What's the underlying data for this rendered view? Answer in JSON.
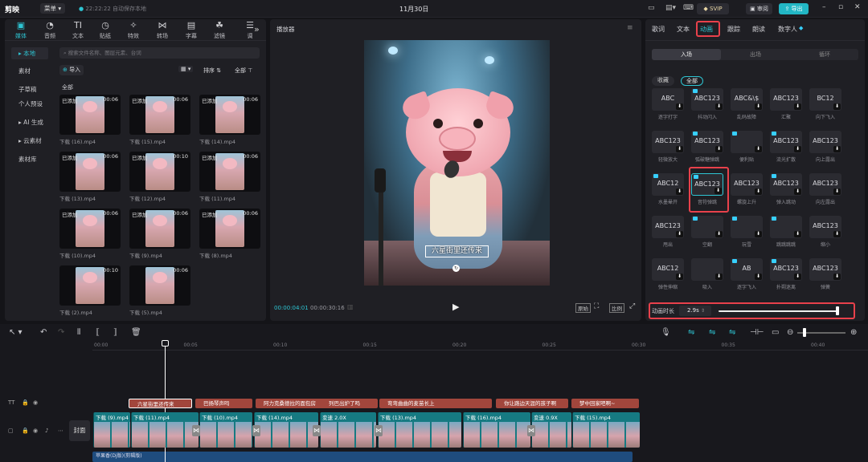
{
  "app": {
    "name": "剪映",
    "menu_label": "菜单",
    "autosave": "22:22:22 自动保存本地",
    "project_date": "11月30日",
    "svip_label": "SVIP",
    "review_label": "审阅",
    "export_label": "导出"
  },
  "toolbar_tabs": [
    {
      "label": "媒体",
      "icon": "media-icon"
    },
    {
      "label": "音频",
      "icon": "audio-icon"
    },
    {
      "label": "文本",
      "icon": "text-icon"
    },
    {
      "label": "贴纸",
      "icon": "sticker-icon"
    },
    {
      "label": "特效",
      "icon": "effects-icon"
    },
    {
      "label": "转场",
      "icon": "transition-icon"
    },
    {
      "label": "字幕",
      "icon": "caption-icon"
    },
    {
      "label": "滤镜",
      "icon": "filter-icon"
    },
    {
      "label": "调",
      "icon": "adjust-icon"
    }
  ],
  "sidebar": {
    "items": [
      "本地",
      "素材",
      "子草稿",
      "个人预设",
      "AI 生成",
      "云素材",
      "素材库"
    ]
  },
  "media": {
    "search_placeholder": "搜索文件名称、图层元素、台词",
    "import_label": "导入",
    "sort_label": "排序",
    "filter_label": "全部",
    "section_label": "全部",
    "items": [
      {
        "name": "下载 (16).mp4",
        "dur": "00:06",
        "added": "已添加"
      },
      {
        "name": "下载 (15).mp4",
        "dur": "00:06",
        "added": "已添加"
      },
      {
        "name": "下载 (14).mp4",
        "dur": "00:06",
        "added": "已添加"
      },
      {
        "name": "下载 (13).mp4",
        "dur": "00:06",
        "added": "已添加"
      },
      {
        "name": "下载 (12).mp4",
        "dur": "00:10",
        "added": "已添加"
      },
      {
        "name": "下载 (11).mp4",
        "dur": "00:06",
        "added": "已添加"
      },
      {
        "name": "下载 (10).mp4",
        "dur": "00:06",
        "added": "已添加"
      },
      {
        "name": "下载 (9).mp4",
        "dur": "00:06",
        "added": "已添加"
      },
      {
        "name": "下载 (8).mp4",
        "dur": "00:06",
        "added": "已添加"
      },
      {
        "name": "下载 (2).mp4",
        "dur": "00:10",
        "added": ""
      },
      {
        "name": "下载 (5).mp4",
        "dur": "00:06",
        "added": ""
      }
    ]
  },
  "player": {
    "title": "播放器",
    "caption": "六星街里还传来",
    "current_time": "00:00:04:01",
    "total_time": "00:00:30:16",
    "ratio_label": "原始",
    "fit_label": "比例"
  },
  "right_panel": {
    "tabs": [
      "歌词",
      "文本",
      "动画",
      "跟踪",
      "朗读",
      "数字人"
    ],
    "active_tab": "动画",
    "sub_tabs": [
      "入场",
      "出场",
      "循环"
    ],
    "filters": [
      "收藏",
      "全部"
    ],
    "animations": [
      {
        "text": "ABC",
        "label": "逐字打字"
      },
      {
        "text": "ABC123",
        "label": "抖动闪入"
      },
      {
        "text": "ABC&\\$",
        "label": "乱码故障"
      },
      {
        "text": "ABC123",
        "label": "汇聚"
      },
      {
        "text": "BC12",
        "label": "向下飞入"
      },
      {
        "text": "ABC123",
        "label": "轻微放大"
      },
      {
        "text": "ABC123",
        "label": "弧破糖弹跳"
      },
      {
        "text": "",
        "label": "便利贴"
      },
      {
        "text": "ABC123",
        "label": "流光扩散"
      },
      {
        "text": "ABC123",
        "label": "向上露出"
      },
      {
        "text": "ABC12",
        "label": "水墨晕开"
      },
      {
        "text": "ABC123",
        "label": "音符弹跳"
      },
      {
        "text": "ABC123",
        "label": "螺旋上升"
      },
      {
        "text": "ABC123",
        "label": "弹入跳动"
      },
      {
        "text": "ABC123",
        "label": "向左露出"
      },
      {
        "text": "ABC123",
        "label": "甩出"
      },
      {
        "text": "",
        "label": "空翻"
      },
      {
        "text": "",
        "label": "玩雪"
      },
      {
        "text": "",
        "label": "跳跳跳跳"
      },
      {
        "text": "ABC123",
        "label": "缩小"
      },
      {
        "text": "ABC12",
        "label": "弹性伸缩"
      },
      {
        "text": "",
        "label": "吸入"
      },
      {
        "text": "AB",
        "label": "逐字飞入"
      },
      {
        "text": "ABC123",
        "label": "扑朔迷离"
      },
      {
        "text": "ABC123",
        "label": "弹簧"
      }
    ],
    "duration_label": "动画时长",
    "duration_value": "2.9s"
  },
  "timeline": {
    "ticks": [
      "00:00",
      "00:05",
      "00:10",
      "00:15",
      "00:20",
      "00:25",
      "00:30",
      "00:35",
      "00:40"
    ],
    "text_clips": [
      "六星街里还传来",
      "巴扬琴声吗",
      "阿力克桑德拉的面包房",
      "列巴出炉了吗",
      "弯弯曲曲的麦苗长上",
      "你让路边天涯的孩子啊",
      "梦中回家吧啊~"
    ],
    "video_clips": [
      "下载 (9).mp4",
      "下载 (11).mp4",
      "下载 (10).mp4",
      "下载 (14).mp4",
      "变速 2.0X",
      "下载 (13).mp4",
      "下载 (16).mp4",
      "变速 0.9X",
      "下载 (15).mp4"
    ],
    "cover_label": "封面",
    "audio_label": "苹果香(Dj版)(剪辑版)"
  }
}
